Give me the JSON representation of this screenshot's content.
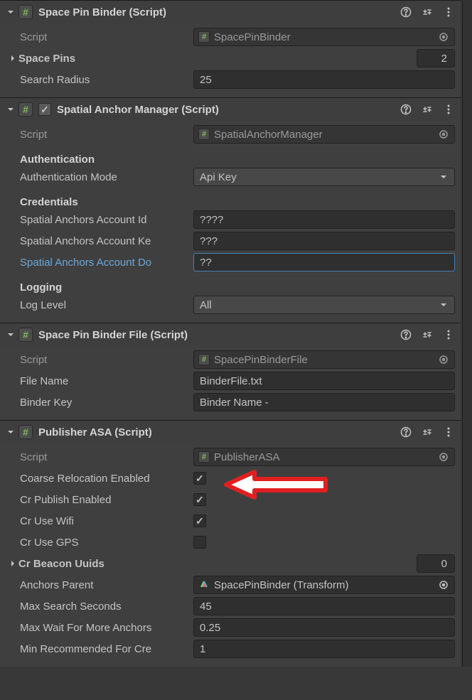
{
  "components": {
    "spb": {
      "title": "Space Pin Binder (Script)",
      "script_label": "Script",
      "script_value": "SpacePinBinder",
      "space_pins_label": "Space Pins",
      "space_pins_value": "2",
      "search_radius_label": "Search Radius",
      "search_radius_value": "25"
    },
    "sam": {
      "title": "Spatial Anchor Manager (Script)",
      "script_label": "Script",
      "script_value": "SpatialAnchorManager",
      "auth_header": "Authentication",
      "auth_mode_label": "Authentication Mode",
      "auth_mode_value": "Api Key",
      "cred_header": "Credentials",
      "acct_id_label": "Spatial Anchors Account Id",
      "acct_id_value": "????",
      "acct_key_label": "Spatial Anchors Account Ke",
      "acct_key_value": "???",
      "acct_dom_label": "Spatial Anchors Account Do",
      "acct_dom_value": "??",
      "log_header": "Logging",
      "log_level_label": "Log Level",
      "log_level_value": "All"
    },
    "spbf": {
      "title": "Space Pin Binder File (Script)",
      "script_label": "Script",
      "script_value": "SpacePinBinderFile",
      "file_name_label": "File Name",
      "file_name_value": "BinderFile.txt",
      "binder_key_label": "Binder Key",
      "binder_key_value": "Binder Name -"
    },
    "pub": {
      "title": "Publisher ASA (Script)",
      "script_label": "Script",
      "script_value": "PublisherASA",
      "coarse_label": "Coarse Relocation Enabled",
      "coarse_checked": true,
      "cr_publish_label": "Cr Publish Enabled",
      "cr_publish_checked": true,
      "cr_wifi_label": "Cr Use Wifi",
      "cr_wifi_checked": true,
      "cr_gps_label": "Cr Use GPS",
      "cr_gps_checked": false,
      "beacon_label": "Cr Beacon Uuids",
      "beacon_value": "0",
      "anchors_parent_label": "Anchors Parent",
      "anchors_parent_value": "SpacePinBinder (Transform)",
      "max_search_label": "Max Search Seconds",
      "max_search_value": "45",
      "max_wait_label": "Max Wait For More Anchors",
      "max_wait_value": "0.25",
      "min_rec_label": "Min Recommended For Cre",
      "min_rec_value": "1"
    }
  }
}
